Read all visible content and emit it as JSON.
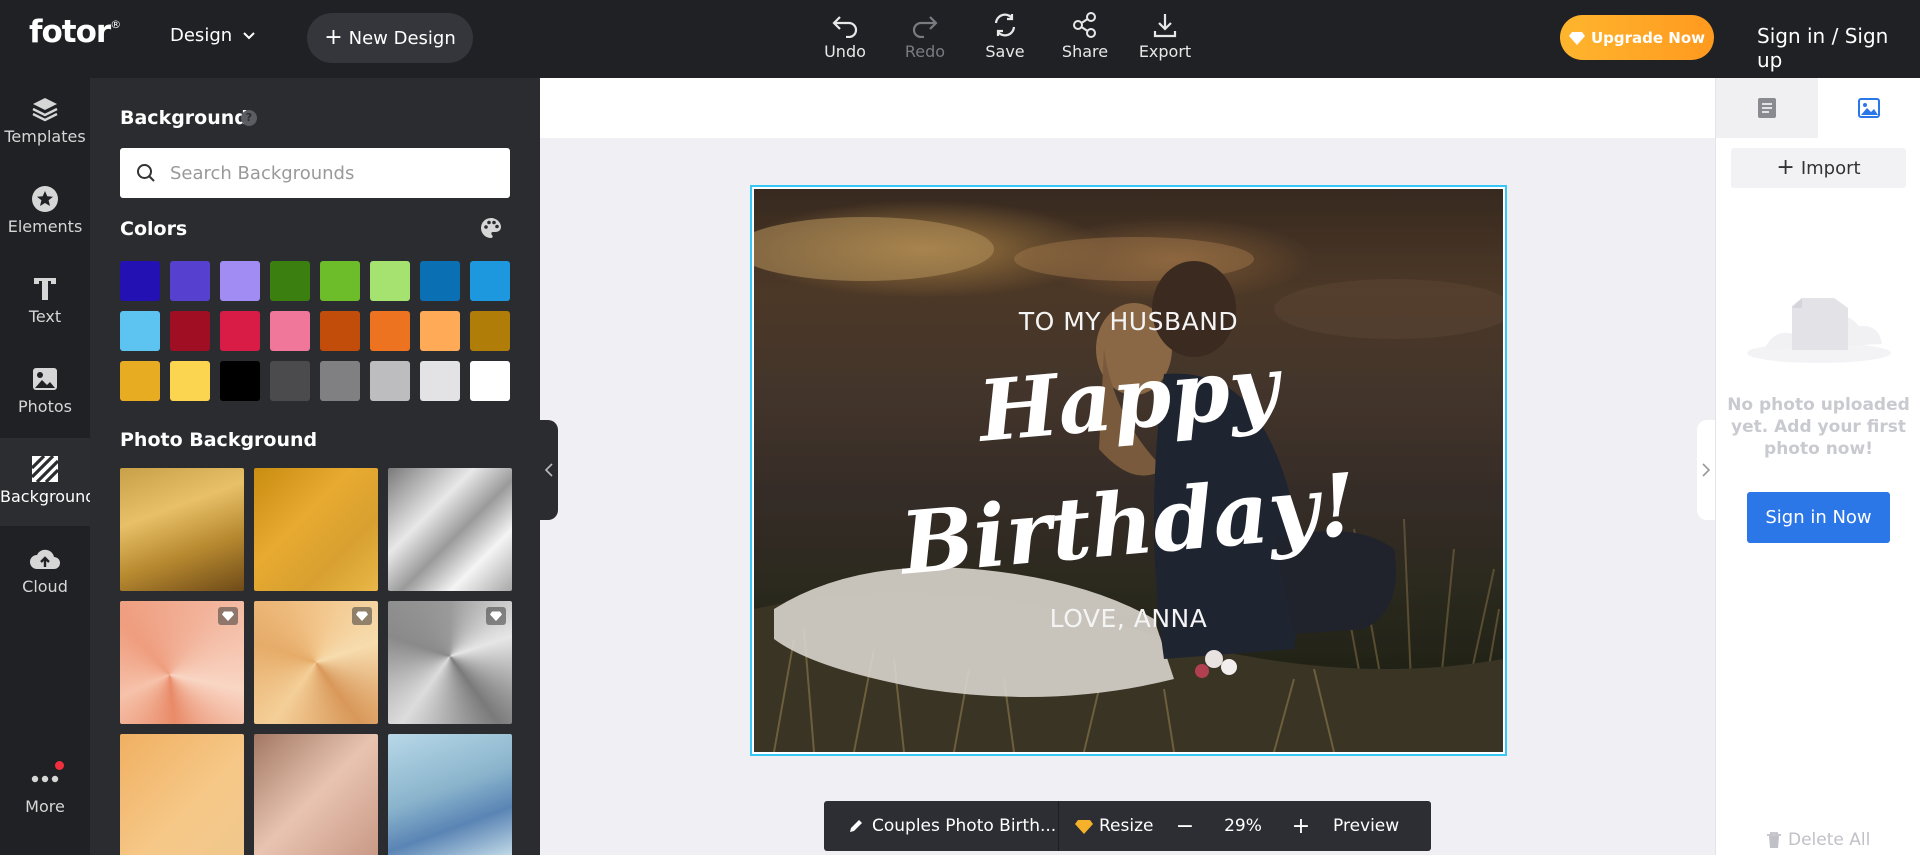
{
  "topbar": {
    "logo": "fotor",
    "logo_mark": "®",
    "design_menu": "Design",
    "new_design": "New Design",
    "tools": [
      {
        "label": "Undo",
        "icon": "undo-icon",
        "enabled": true
      },
      {
        "label": "Redo",
        "icon": "redo-icon",
        "enabled": false
      },
      {
        "label": "Save",
        "icon": "save-icon",
        "enabled": true
      },
      {
        "label": "Share",
        "icon": "share-icon",
        "enabled": true
      },
      {
        "label": "Export",
        "icon": "export-icon",
        "enabled": true
      }
    ],
    "upgrade": "Upgrade Now",
    "signin": "Sign in",
    "signin_sep": "/",
    "signup": "Sign up"
  },
  "rail": {
    "items": [
      {
        "label": "Templates",
        "icon": "layers-icon"
      },
      {
        "label": "Elements",
        "icon": "star-icon"
      },
      {
        "label": "Text",
        "icon": "text-icon"
      },
      {
        "label": "Photos",
        "icon": "image-icon"
      },
      {
        "label": "Background",
        "icon": "background-icon",
        "active": true
      },
      {
        "label": "Cloud",
        "icon": "cloud-icon"
      }
    ],
    "more": "More"
  },
  "panel": {
    "title": "Background",
    "help": "?",
    "search_placeholder": "Search Backgrounds",
    "colors_title": "Colors",
    "colors": [
      "#2411b3",
      "#5540d0",
      "#a08cf3",
      "#3a7f10",
      "#6cbd29",
      "#a6e26f",
      "#0a6fb3",
      "#1d98de",
      "#5dc3f1",
      "#a00e24",
      "#d81c45",
      "#f0779a",
      "#c24d0a",
      "#ee7320",
      "#ffaa56",
      "#b07d08",
      "#e8ac22",
      "#fcd550",
      "#000000",
      "#4b4b4d",
      "#808083",
      "#bdbdbf",
      "#e3e3e6",
      "#ffffff"
    ],
    "photo_title": "Photo Background",
    "photo_tiles": [
      {
        "style": "gold-satin",
        "premium": false
      },
      {
        "style": "gold-brushed",
        "premium": false
      },
      {
        "style": "silver-brushed",
        "premium": false
      },
      {
        "style": "rose-gold-radial",
        "premium": true
      },
      {
        "style": "gold-radial",
        "premium": true
      },
      {
        "style": "silver-radial",
        "premium": true
      },
      {
        "style": "peach-gradient",
        "premium": false
      },
      {
        "style": "rose-gradient",
        "premium": false
      },
      {
        "style": "blue-gradient",
        "premium": false
      }
    ]
  },
  "canvas": {
    "line1": "TO MY HUSBAND",
    "line2": "Happy",
    "line3": "Birthday!",
    "line4": "LOVE, ANNA"
  },
  "bottombar": {
    "design_name": "Couples Photo Birth...",
    "resize": "Resize",
    "zoom_out": "−",
    "zoom": "29%",
    "zoom_in": "+",
    "preview": "Preview"
  },
  "rpanel": {
    "tabs": [
      {
        "icon": "document-icon"
      },
      {
        "icon": "image-icon",
        "active": true
      }
    ],
    "import": "Import",
    "empty_text": "No photo uploaded yet. Add your first photo now!",
    "signin_now": "Sign in Now",
    "delete_all": "Delete All"
  }
}
